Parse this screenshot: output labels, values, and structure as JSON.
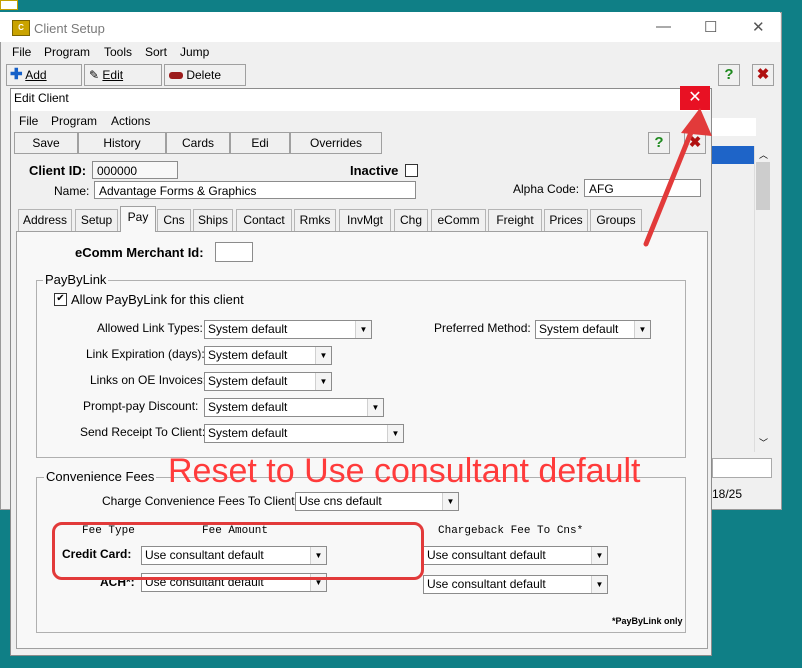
{
  "app": {
    "title": "Client Setup",
    "menu": [
      "File",
      "Program",
      "Tools",
      "Sort",
      "Jump"
    ],
    "toolbar": {
      "add": "Add",
      "edit": "Edit",
      "delete": "Delete"
    },
    "date_fragment": "18/25"
  },
  "dialog": {
    "title": "Edit Client",
    "menu": [
      "File",
      "Program",
      "Actions"
    ],
    "buttons": [
      "Save",
      "History",
      "Cards",
      "Edi",
      "Overrides"
    ],
    "client_id_label": "Client ID:",
    "client_id": "000000",
    "inactive_label": "Inactive",
    "name_label": "Name:",
    "name": "Advantage Forms & Graphics",
    "alpha_label": "Alpha Code:",
    "alpha_code": "AFG",
    "tabs": [
      "Address",
      "Setup",
      "Pay",
      "Cns",
      "Ships",
      "Contact",
      "Rmks",
      "InvMgt",
      "Chg",
      "eComm",
      "Freight",
      "Prices",
      "Groups"
    ],
    "active_tab": "Pay"
  },
  "pay": {
    "ecomm_label": "eComm Merchant Id:",
    "ecomm_value": "",
    "paybylink": {
      "title": "PayByLink",
      "allow_label": "Allow PayByLink for this client",
      "allow_checked": "✔",
      "allowed_types_label": "Allowed Link Types:",
      "allowed_types": "System default",
      "expiration_label": "Link Expiration (days):",
      "expiration": "System default",
      "oe_label": "Links on OE Invoices:",
      "oe": "System default",
      "discount_label": "Prompt-pay Discount:",
      "discount": "System default",
      "receipt_label": "Send Receipt To Client:",
      "receipt": "System default",
      "preferred_label": "Preferred Method:",
      "preferred": "System default"
    },
    "fees": {
      "title": "Convenience Fees",
      "charge_label": "Charge Convenience Fees To Client:",
      "charge": "Use cns default",
      "fee_type_header": "Fee Type",
      "fee_amount_header": "Fee Amount",
      "chargeback_header": "Chargeback Fee To Cns*",
      "credit_label": "Credit Card:",
      "credit_amount": "Use consultant default",
      "credit_chargeback": "Use consultant default",
      "ach_label": "ACH*:",
      "ach_amount": "Use consultant default",
      "ach_chargeback": "Use consultant default",
      "footnote": "*PayByLink only"
    }
  },
  "annotation": {
    "text": "Reset to Use consultant default"
  },
  "colors": {
    "desktop": "#0f7f86",
    "close_button": "#e81123",
    "annotation": "#ff3b3b"
  }
}
